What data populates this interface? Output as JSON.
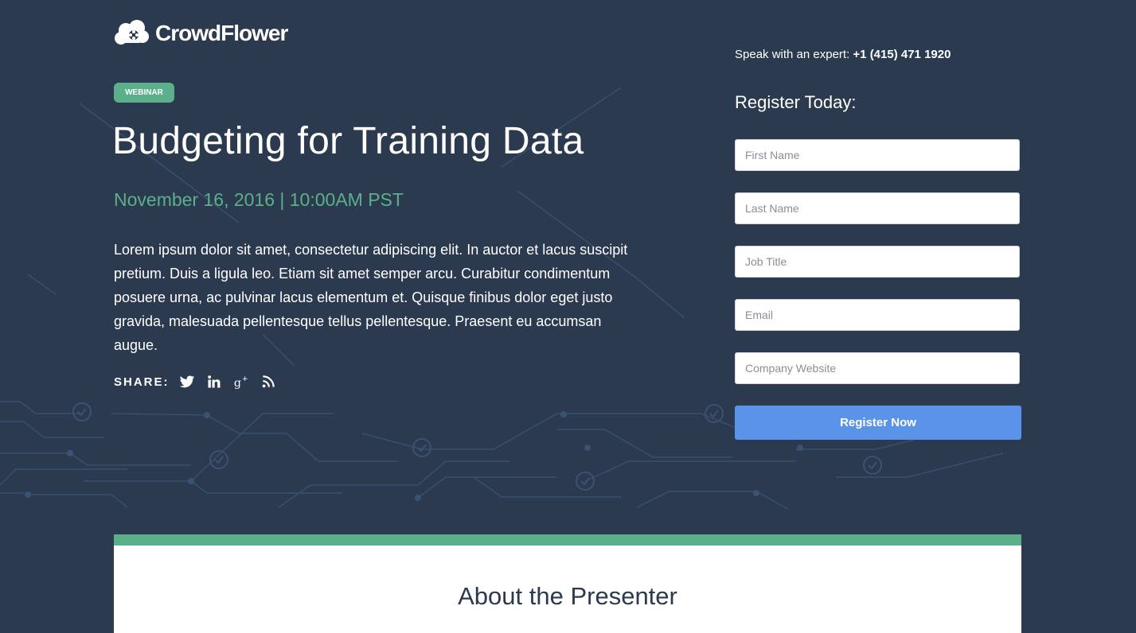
{
  "logo": {
    "text": "CrowdFlower",
    "icon": "cloud-flower-logo-icon"
  },
  "hero": {
    "badge": "WEBINAR",
    "title": "Budgeting for Training Data",
    "date": "November 16, 2016 | 10:00AM PST",
    "description": "Lorem ipsum dolor sit amet, consectetur adipiscing elit. In auctor et lacus suscipit pretium. Duis a ligula leo. Etiam sit amet semper arcu. Curabitur condimentum posuere urna, ac pulvinar lacus elementum et. Quisque finibus dolor eget justo gravida, malesuada pellentesque tellus pellentesque. Praesent eu accumsan augue.",
    "share_label": "SHARE:",
    "share_icons": [
      "twitter-icon",
      "linkedin-icon",
      "google-plus-icon",
      "rss-icon"
    ]
  },
  "contact": {
    "prefix": "Speak with an expert: ",
    "phone": "+1 (415) 471 1920"
  },
  "form": {
    "title": "Register Today:",
    "fields": [
      {
        "placeholder": "First Name",
        "value": ""
      },
      {
        "placeholder": "Last Name",
        "value": ""
      },
      {
        "placeholder": "Job Title",
        "value": ""
      },
      {
        "placeholder": "Email",
        "value": ""
      },
      {
        "placeholder": "Company Website",
        "value": ""
      }
    ],
    "submit_label": "Register Now"
  },
  "about": {
    "title": "About the Presenter"
  },
  "colors": {
    "background": "#2c3a4f",
    "accent_green": "#5bb08b",
    "button_blue": "#5b93e8",
    "white": "#ffffff"
  }
}
